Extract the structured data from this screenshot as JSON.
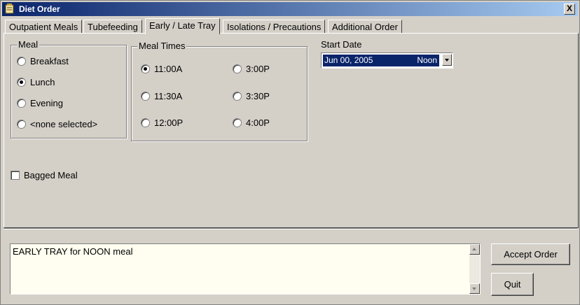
{
  "window": {
    "title": "Diet Order",
    "close_label": "X"
  },
  "tabs": [
    {
      "label": "Outpatient Meals"
    },
    {
      "label": "Tubefeeding"
    },
    {
      "label": "Early / Late Tray"
    },
    {
      "label": "Isolations / Precautions"
    },
    {
      "label": "Additional Order"
    }
  ],
  "active_tab": "Early / Late Tray",
  "meal_group": {
    "label": "Meal",
    "options": [
      "Breakfast",
      "Lunch",
      "Evening",
      "<none selected>"
    ],
    "selected": "Lunch"
  },
  "meal_times_group": {
    "label": "Meal Times",
    "options": [
      "11:00A",
      "3:00P",
      "11:30A",
      "3:30P",
      "12:00P",
      "4:00P"
    ],
    "selected": "11:00A"
  },
  "start_date": {
    "label": "Start Date",
    "date": "Jun 00, 2005",
    "time": "Noon"
  },
  "bagged_meal": {
    "label": "Bagged Meal",
    "checked": false
  },
  "memo": {
    "text": "EARLY TRAY for NOON meal"
  },
  "buttons": {
    "accept": "Accept Order",
    "quit": "Quit"
  }
}
